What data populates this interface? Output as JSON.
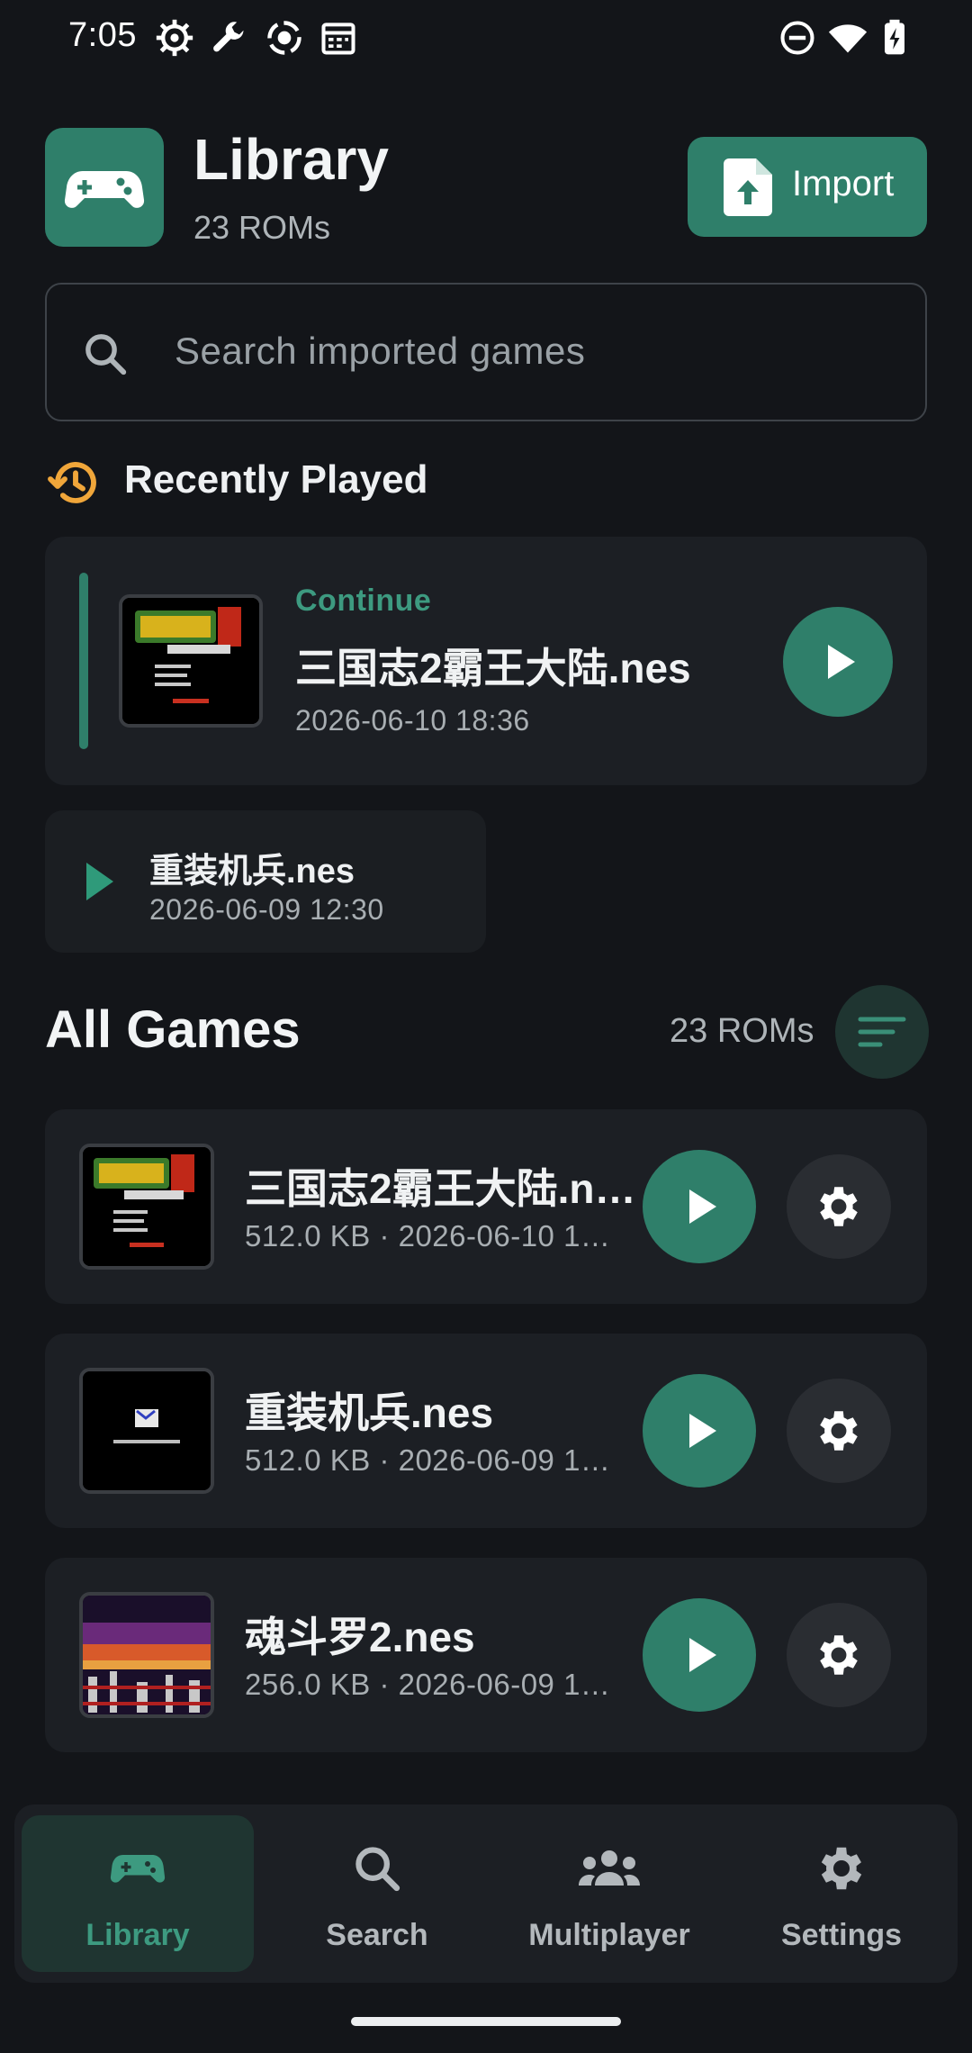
{
  "status_bar": {
    "time": "7:05",
    "left_icons": [
      "settings-cog-icon",
      "wrench-icon",
      "record-target-icon",
      "calendar-icon"
    ],
    "right_icons": [
      "do-not-disturb-icon",
      "wifi-icon",
      "battery-charging-icon"
    ]
  },
  "header": {
    "title": "Library",
    "subtitle": "23 ROMs",
    "import_label": "Import"
  },
  "search": {
    "placeholder": "Search imported games"
  },
  "recently_played": {
    "title": "Recently Played",
    "continue_card": {
      "label": "Continue",
      "name": "三国志2霸王大陆.nes",
      "date": "2026-06-10 18:36"
    },
    "items": [
      {
        "name": "重装机兵.nes",
        "date": "2026-06-09 12:30"
      }
    ]
  },
  "all_games": {
    "title": "All Games",
    "count": "23 ROMs",
    "items": [
      {
        "name": "三国志2霸王大陆.n…",
        "meta": "512.0 KB · 2026-06-10 1…"
      },
      {
        "name": "重装机兵.nes",
        "meta": "512.0 KB · 2026-06-09 1…"
      },
      {
        "name": "魂斗罗2.nes",
        "meta": "256.0 KB · 2026-06-09 1…"
      }
    ]
  },
  "nav": {
    "items": [
      {
        "label": "Library",
        "icon": "gamepad-icon",
        "active": true
      },
      {
        "label": "Search",
        "icon": "search-icon",
        "active": false
      },
      {
        "label": "Multiplayer",
        "icon": "group-icon",
        "active": false
      },
      {
        "label": "Settings",
        "icon": "gear-icon",
        "active": false
      }
    ]
  },
  "colors": {
    "accent": "#2f7f6a",
    "accent_text": "#3d9a80",
    "background": "#131519",
    "card": "#1c1f24"
  }
}
